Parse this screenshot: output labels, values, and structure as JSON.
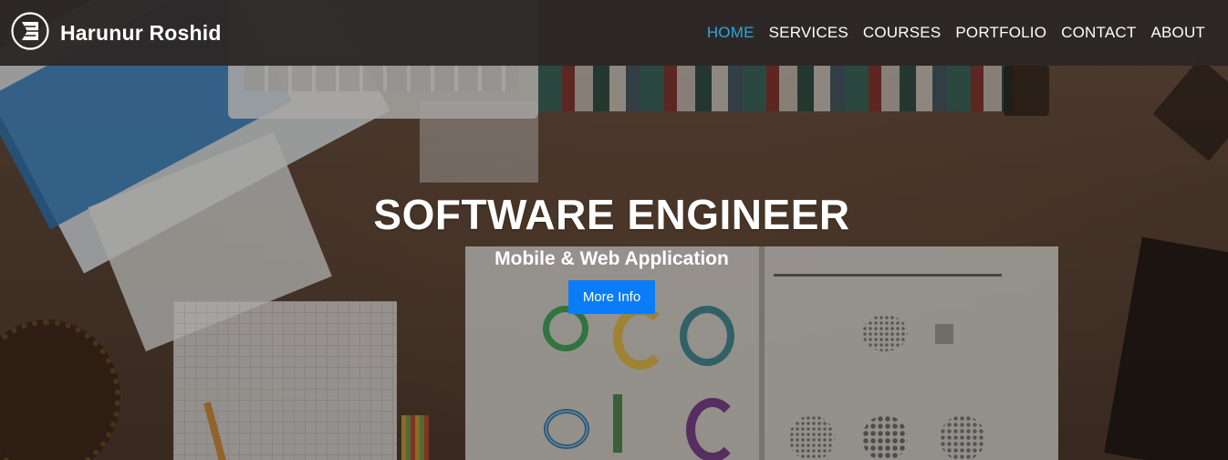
{
  "brand": {
    "name": "Harunur Roshid",
    "icon": "brand-logo-icon"
  },
  "nav": {
    "items": [
      {
        "label": "HOME",
        "active": true
      },
      {
        "label": "SERVICES",
        "active": false
      },
      {
        "label": "COURSES",
        "active": false
      },
      {
        "label": "PORTFOLIO",
        "active": false
      },
      {
        "label": "CONTACT",
        "active": false
      },
      {
        "label": "ABOUT",
        "active": false
      }
    ]
  },
  "hero": {
    "title": "SOFTWARE ENGINEER",
    "subtitle": "Mobile & Web Application",
    "button_label": "More Info"
  },
  "colors": {
    "accent": "#2aa7e0",
    "button": "#0b7cf7",
    "navbar": "#2c2826"
  }
}
